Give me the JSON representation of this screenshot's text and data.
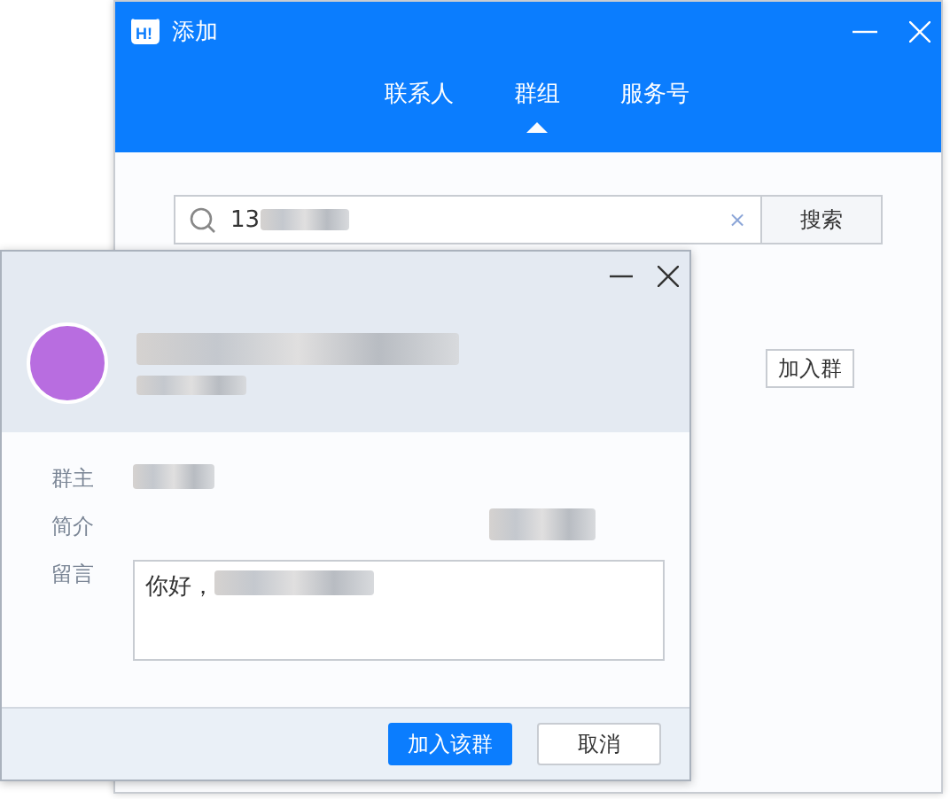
{
  "back_window": {
    "logo_text": "H!",
    "title": "添加",
    "tabs": [
      {
        "label": "联系人",
        "selected": false
      },
      {
        "label": "群组",
        "selected": true
      },
      {
        "label": "服务号",
        "selected": false
      }
    ],
    "search": {
      "value": "13",
      "clear": "×",
      "button": "搜索"
    },
    "join_button": "加入群"
  },
  "dialog": {
    "fields": [
      {
        "label": "群主"
      },
      {
        "label": "简介"
      },
      {
        "label": "留言"
      }
    ],
    "message": "你好，",
    "buttons": [
      {
        "label": "加入该群",
        "kind": "primary"
      },
      {
        "label": "取消",
        "kind": "secondary"
      }
    ]
  }
}
